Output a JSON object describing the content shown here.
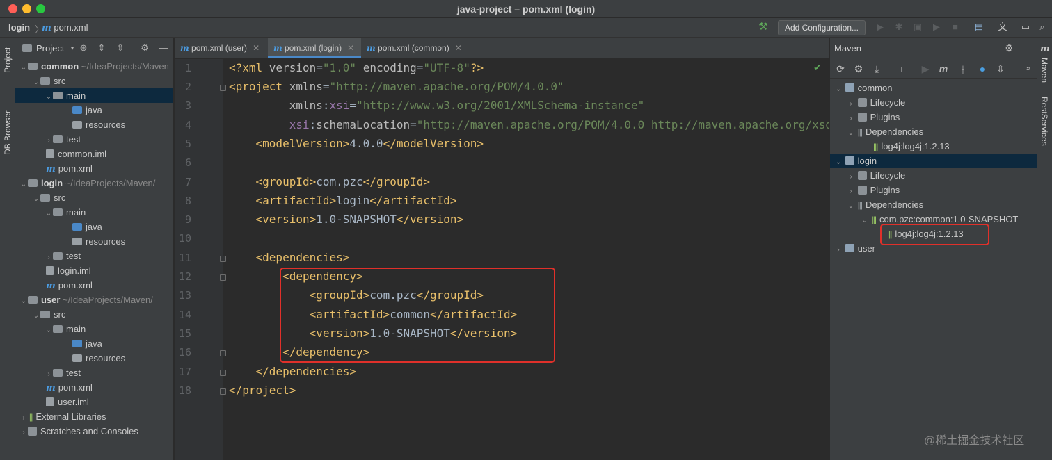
{
  "window": {
    "title": "java-project – pom.xml (login)"
  },
  "navbar": {
    "crumb_module": "login",
    "crumb_file": "pom.xml",
    "add_configuration": "Add Configuration..."
  },
  "left_strip": {
    "project": "Project",
    "db_browser": "DB Browser"
  },
  "project_panel": {
    "title": "Project",
    "tree": [
      {
        "label": "common",
        "path": "~/IdeaProjects/Maven",
        "kind": "module"
      },
      {
        "label": "src"
      },
      {
        "label": "main"
      },
      {
        "label": "java"
      },
      {
        "label": "resources"
      },
      {
        "label": "test"
      },
      {
        "label": "common.iml"
      },
      {
        "label": "pom.xml"
      },
      {
        "label": "login",
        "path": "~/IdeaProjects/Maven/",
        "kind": "module"
      },
      {
        "label": "src"
      },
      {
        "label": "main"
      },
      {
        "label": "java"
      },
      {
        "label": "resources"
      },
      {
        "label": "test"
      },
      {
        "label": "login.iml"
      },
      {
        "label": "pom.xml"
      },
      {
        "label": "user",
        "path": "~/IdeaProjects/Maven/",
        "kind": "module"
      },
      {
        "label": "src"
      },
      {
        "label": "main"
      },
      {
        "label": "java"
      },
      {
        "label": "resources"
      },
      {
        "label": "test"
      },
      {
        "label": "pom.xml"
      },
      {
        "label": "user.iml"
      },
      {
        "label": "External Libraries"
      },
      {
        "label": "Scratches and Consoles"
      }
    ]
  },
  "tabs": [
    {
      "label": "pom.xml (user)"
    },
    {
      "label": "pom.xml (login)"
    },
    {
      "label": "pom.xml (common)"
    }
  ],
  "editor": {
    "line_numbers": [
      "1",
      "2",
      "3",
      "4",
      "5",
      "6",
      "7",
      "8",
      "9",
      "10",
      "11",
      "12",
      "13",
      "14",
      "15",
      "16",
      "17",
      "18"
    ]
  },
  "maven_panel": {
    "title": "Maven",
    "tree": [
      {
        "label": "common"
      },
      {
        "label": "Lifecycle"
      },
      {
        "label": "Plugins"
      },
      {
        "label": "Dependencies"
      },
      {
        "label": "log4j:log4j:1.2.13"
      },
      {
        "label": "login"
      },
      {
        "label": "Lifecycle"
      },
      {
        "label": "Plugins"
      },
      {
        "label": "Dependencies"
      },
      {
        "label": "com.pzc:common:1.0-SNAPSHOT"
      },
      {
        "label": "log4j:log4j:1.2.13"
      },
      {
        "label": "user"
      }
    ]
  },
  "right_strip": {
    "maven": "Maven",
    "rest_services": "RestServices"
  },
  "watermark": "@稀土掘金技术社区",
  "colors": {
    "highlight_box": "#e0302a",
    "selection": "#0d293e",
    "accent": "#4a88c7"
  }
}
